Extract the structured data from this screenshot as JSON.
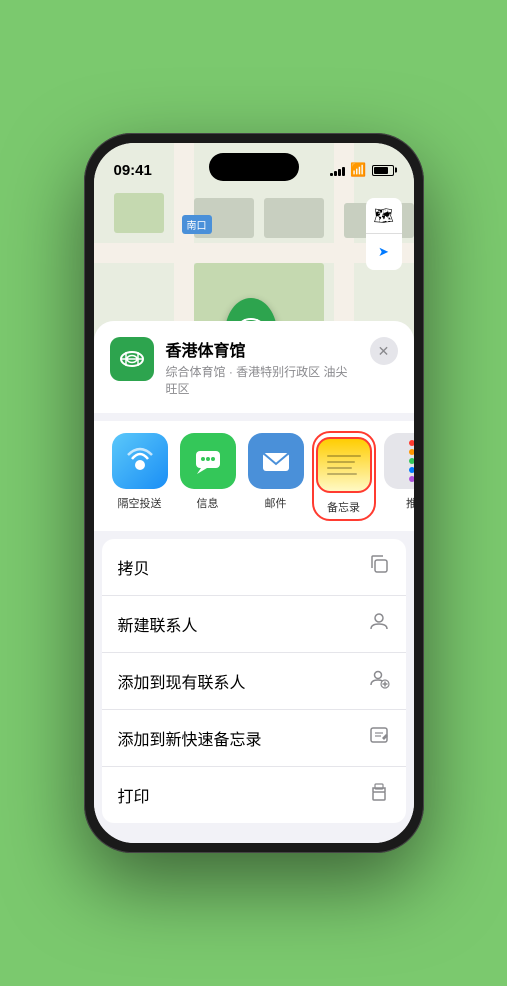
{
  "status_bar": {
    "time": "09:41",
    "arrow_icon": "▲"
  },
  "map": {
    "location_label": "南口",
    "pin_label": "香港体育馆"
  },
  "venue": {
    "name": "香港体育馆",
    "description": "综合体育馆 · 香港特别行政区 油尖旺区",
    "close_label": "✕"
  },
  "share_items": [
    {
      "id": "airdrop",
      "label": "隔空投送",
      "icon_type": "airdrop"
    },
    {
      "id": "messages",
      "label": "信息",
      "icon_type": "messages"
    },
    {
      "id": "mail",
      "label": "邮件",
      "icon_type": "mail"
    },
    {
      "id": "notes",
      "label": "备忘录",
      "icon_type": "notes"
    },
    {
      "id": "more",
      "label": "推",
      "icon_type": "more"
    }
  ],
  "actions": [
    {
      "label": "拷贝",
      "icon": "📋"
    },
    {
      "label": "新建联系人",
      "icon": "👤"
    },
    {
      "label": "添加到现有联系人",
      "icon": "👤"
    },
    {
      "label": "添加到新快速备忘录",
      "icon": "📝"
    },
    {
      "label": "打印",
      "icon": "🖨"
    }
  ],
  "more_dots": {
    "colors": [
      "#ff3b30",
      "#ff9500",
      "#34c759",
      "#007aff",
      "#af52de"
    ]
  },
  "icons": {
    "map_layers": "🗺",
    "location_arrow": "➤",
    "airdrop_symbol": "📡",
    "messages_symbol": "💬",
    "mail_symbol": "✉"
  }
}
